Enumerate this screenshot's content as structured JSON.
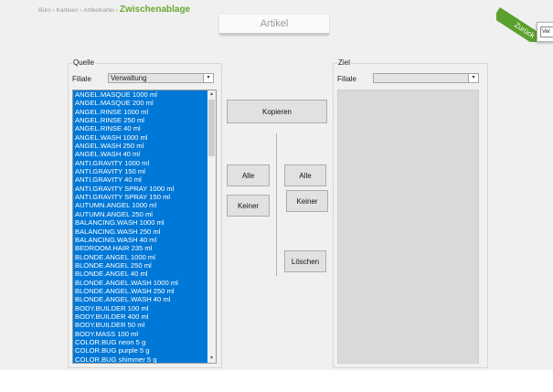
{
  "breadcrumb": {
    "path": "Büro › Karteien › Artikelkartei ›",
    "current": "Zwischenablage"
  },
  "title_tab": "Artikel",
  "ribbon": {
    "label": "Zurück"
  },
  "popup": {
    "text": "Ver"
  },
  "source": {
    "group_label": "Quelle",
    "filiale_label": "Filiale",
    "filiale_value": "Verwaltung",
    "items": [
      "ANGEL.MASQUE 1000 ml",
      "ANGEL.MASQUE 200 ml",
      "ANGEL.RINSE 1000 ml",
      "ANGEL.RINSE 250 ml",
      "ANGEL.RINSE 40 ml",
      "ANGEL.WASH 1000 ml",
      "ANGEL.WASH 250 ml",
      "ANGEL.WASH 40 ml",
      "ANTI.GRAVITY 1000 ml",
      "ANTI.GRAVITY 150 ml",
      "ANTI.GRAVITY 40 ml",
      "ANTI.GRAVITY SPRAY 1000 ml",
      "ANTI.GRAVITY SPRAY 150 ml",
      "AUTUMN.ANGEL 1000 ml",
      "AUTUMN.ANGEL 250 ml",
      "BALANCING.WASH 1000 ml",
      "BALANCING.WASH 250 ml",
      "BALANCING.WASH 40 ml",
      "BEDROOM.HAIR 235 ml",
      "BLONDE.ANGEL 1000 ml",
      "BLONDE.ANGEL 250 ml",
      "BLONDE.ANGEL 40 ml",
      "BLONDE.ANGEL.WASH 1000 ml",
      "BLONDE.ANGEL.WASH 250 ml",
      "BLONDE.ANGEL.WASH 40 ml",
      "BODY.BUILDER 100 ml",
      "BODY.BUILDER 400 ml",
      "BODY.BUILDER 50 ml",
      "BODY.MASS 100 ml",
      "COLOR.BUG neon 5 g",
      "COLOR.BUG purple 5 g",
      "COLOR.BUG shimmer 5 g"
    ]
  },
  "target": {
    "group_label": "Ziel",
    "filiale_label": "Filiale",
    "filiale_value": ""
  },
  "buttons": {
    "kopieren": "Kopieren",
    "alle_left": "Alle",
    "keiner_left": "Keiner",
    "alle_right": "Alle",
    "keiner_right": "Keiner",
    "loeschen": "Löschen"
  },
  "icons": {
    "dropdown": "▾",
    "scroll_up": "▴",
    "scroll_down": "▾"
  }
}
